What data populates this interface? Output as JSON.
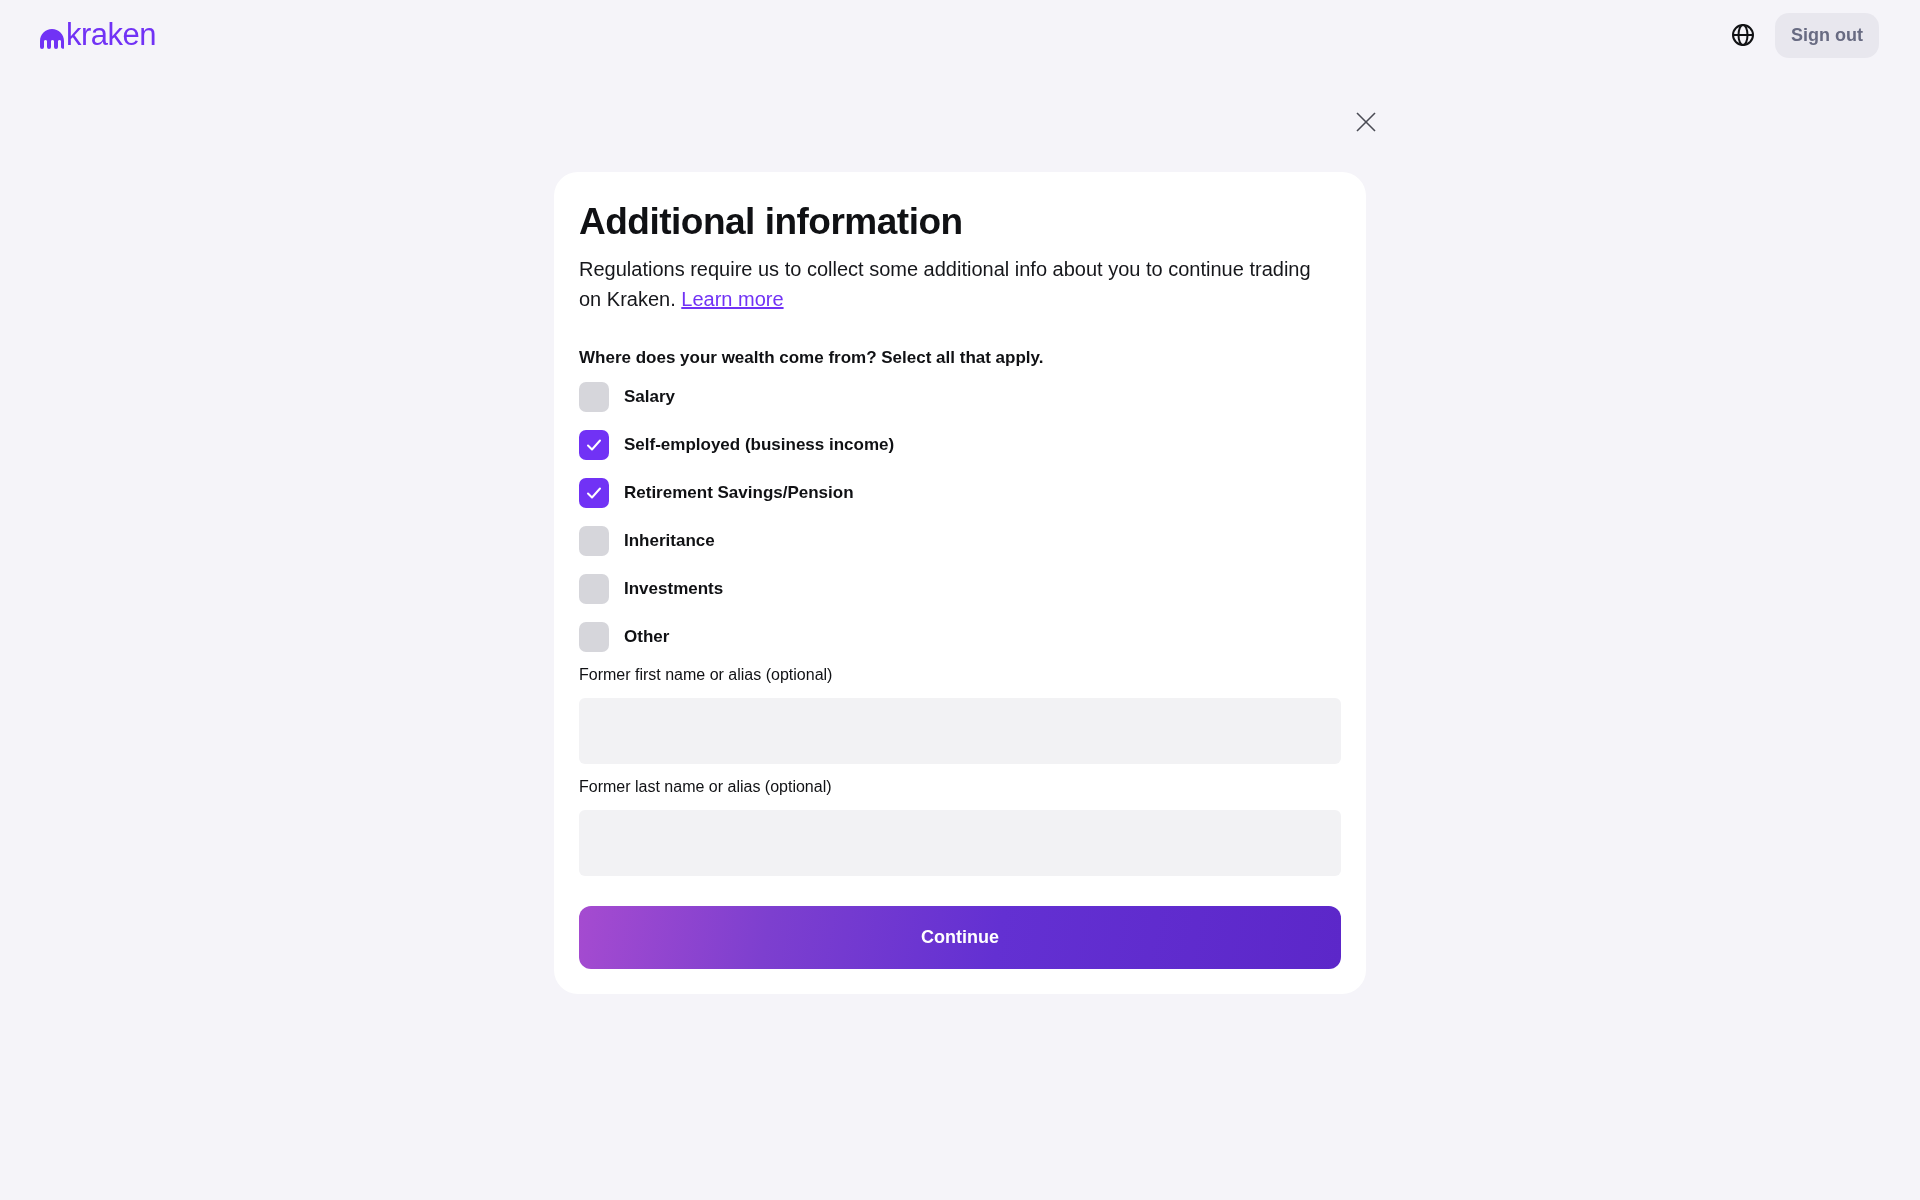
{
  "header": {
    "logo": "kraken",
    "sign_out": "Sign out"
  },
  "form": {
    "title": "Additional information",
    "description": "Regulations require us to collect some additional info about you to continue trading on Kraken.",
    "link": "Learn more",
    "question": "Where does your wealth come from? Select all that apply.",
    "options": [
      {
        "label": "Salary",
        "checked": false
      },
      {
        "label": "Self-employed (business income)",
        "checked": true
      },
      {
        "label": "Retirement Savings/Pension",
        "checked": true
      },
      {
        "label": "Inheritance",
        "checked": false
      },
      {
        "label": "Investments",
        "checked": false
      },
      {
        "label": "Other",
        "checked": false
      }
    ],
    "fields": [
      {
        "label": "Former first name or alias (optional)"
      },
      {
        "label": "Former last name or alias (optional)"
      }
    ],
    "submit": "Continue"
  }
}
